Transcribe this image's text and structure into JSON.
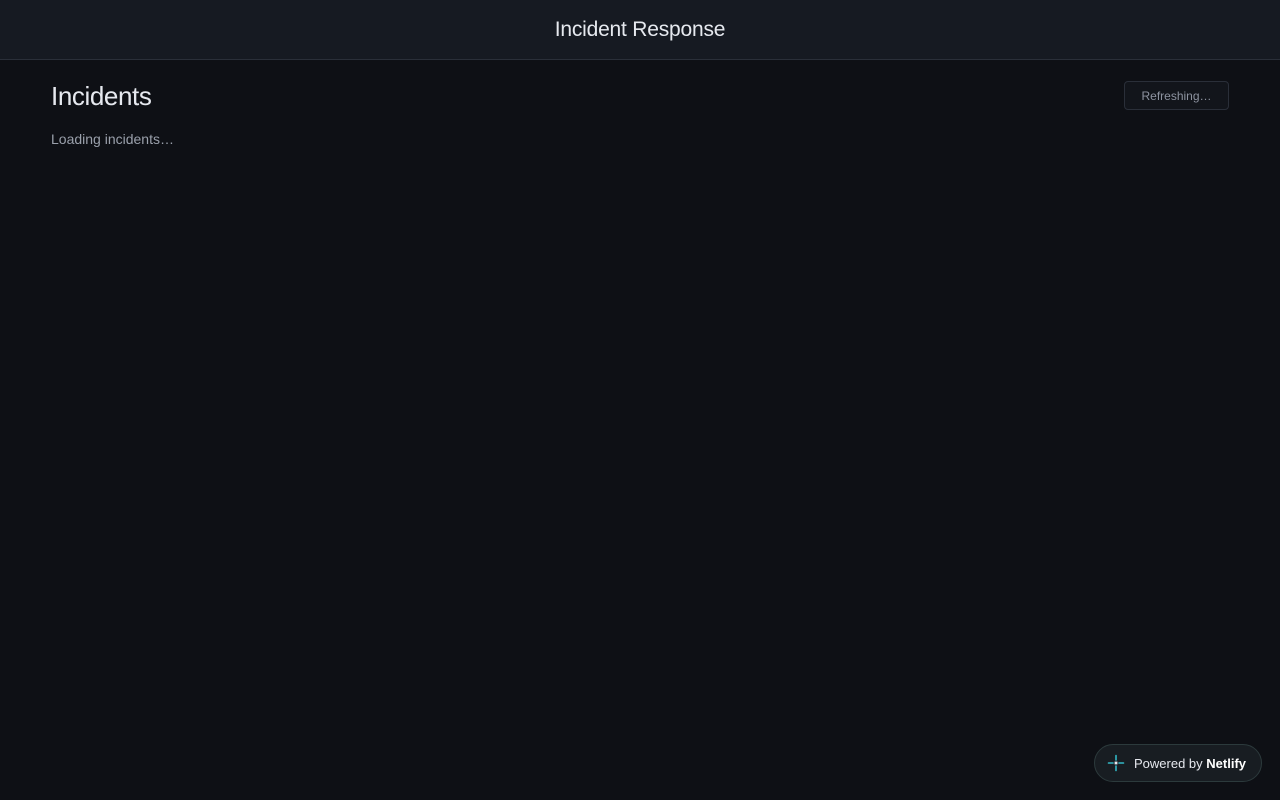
{
  "header": {
    "title": "Incident Response"
  },
  "main": {
    "title": "Incidents",
    "refresh_label": "Refreshing…",
    "loading_text": "Loading incidents…"
  },
  "badge": {
    "prefix": "Powered by",
    "brand": "Netlify",
    "icon": "netlify-icon"
  },
  "colors": {
    "background": "#0e1015",
    "header_background": "#161a22",
    "text_primary": "#e6e9ef",
    "text_muted": "#9aa0ab",
    "netlify_accent": "#32b8c6"
  }
}
